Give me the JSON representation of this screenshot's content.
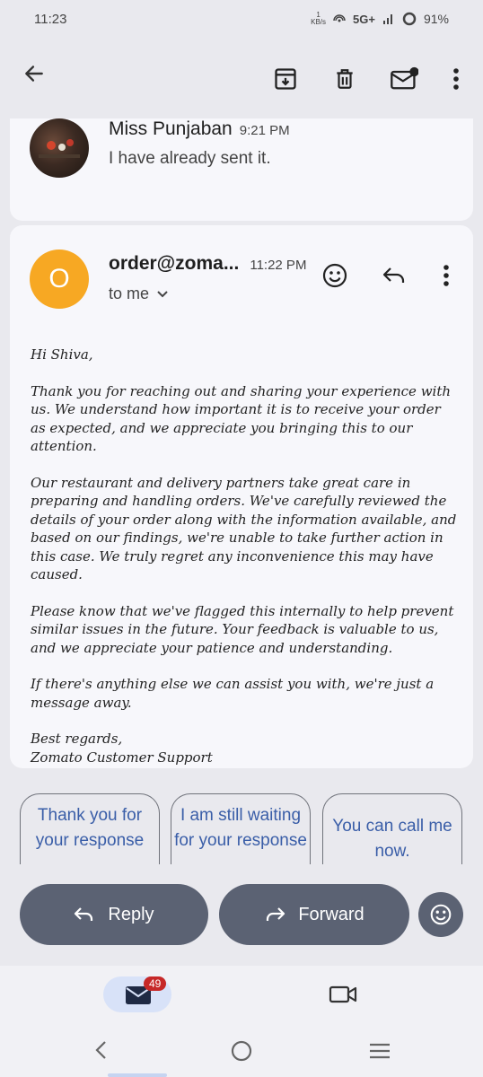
{
  "status_bar": {
    "time": "11:23",
    "speed_top": "1",
    "speed_unit": "KB/s",
    "network": "5G+",
    "battery": "91%"
  },
  "toolbar": {
    "back_icon": "arrow-left-icon",
    "archive_icon": "archive-icon",
    "delete_icon": "trash-icon",
    "mark_unread_icon": "mail-unread-icon",
    "more_icon": "more-vert-icon"
  },
  "message1": {
    "sender": "Miss Punjaban",
    "time": "9:21 PM",
    "preview": "I have already sent it."
  },
  "message2": {
    "avatar_letter": "O",
    "avatar_color": "#f7a823",
    "sender": "order@zoma...",
    "time": "11:22 PM",
    "recipient": "to me",
    "body": {
      "greeting": "Hi Shiva,",
      "p1": "Thank you for reaching out and sharing your experience with us. We understand how important it is to receive your order as expected, and we appreciate you bringing this to our attention.",
      "p2": "Our restaurant and delivery partners take great care in preparing and handling orders. We've carefully reviewed the details of your order along with the information available, and based on our findings, we're unable to take further action in this case. We truly regret any inconvenience this may have caused.",
      "p3": "Please know that we've flagged this internally to help prevent similar issues in the future. Your feedback is valuable to us, and we appreciate your patience and understanding.",
      "p4": "If there's anything else we can assist you with, we're just a message away.",
      "signoff": "Best regards,",
      "signature": "Zomato Customer Support"
    }
  },
  "smart_replies": [
    "Thank you for your response",
    "I am still waiting for your response",
    "You can call me now."
  ],
  "actions": {
    "reply": "Reply",
    "forward": "Forward"
  },
  "bottom_nav": {
    "mail_badge": "49"
  },
  "accent_color": "#5b6273"
}
